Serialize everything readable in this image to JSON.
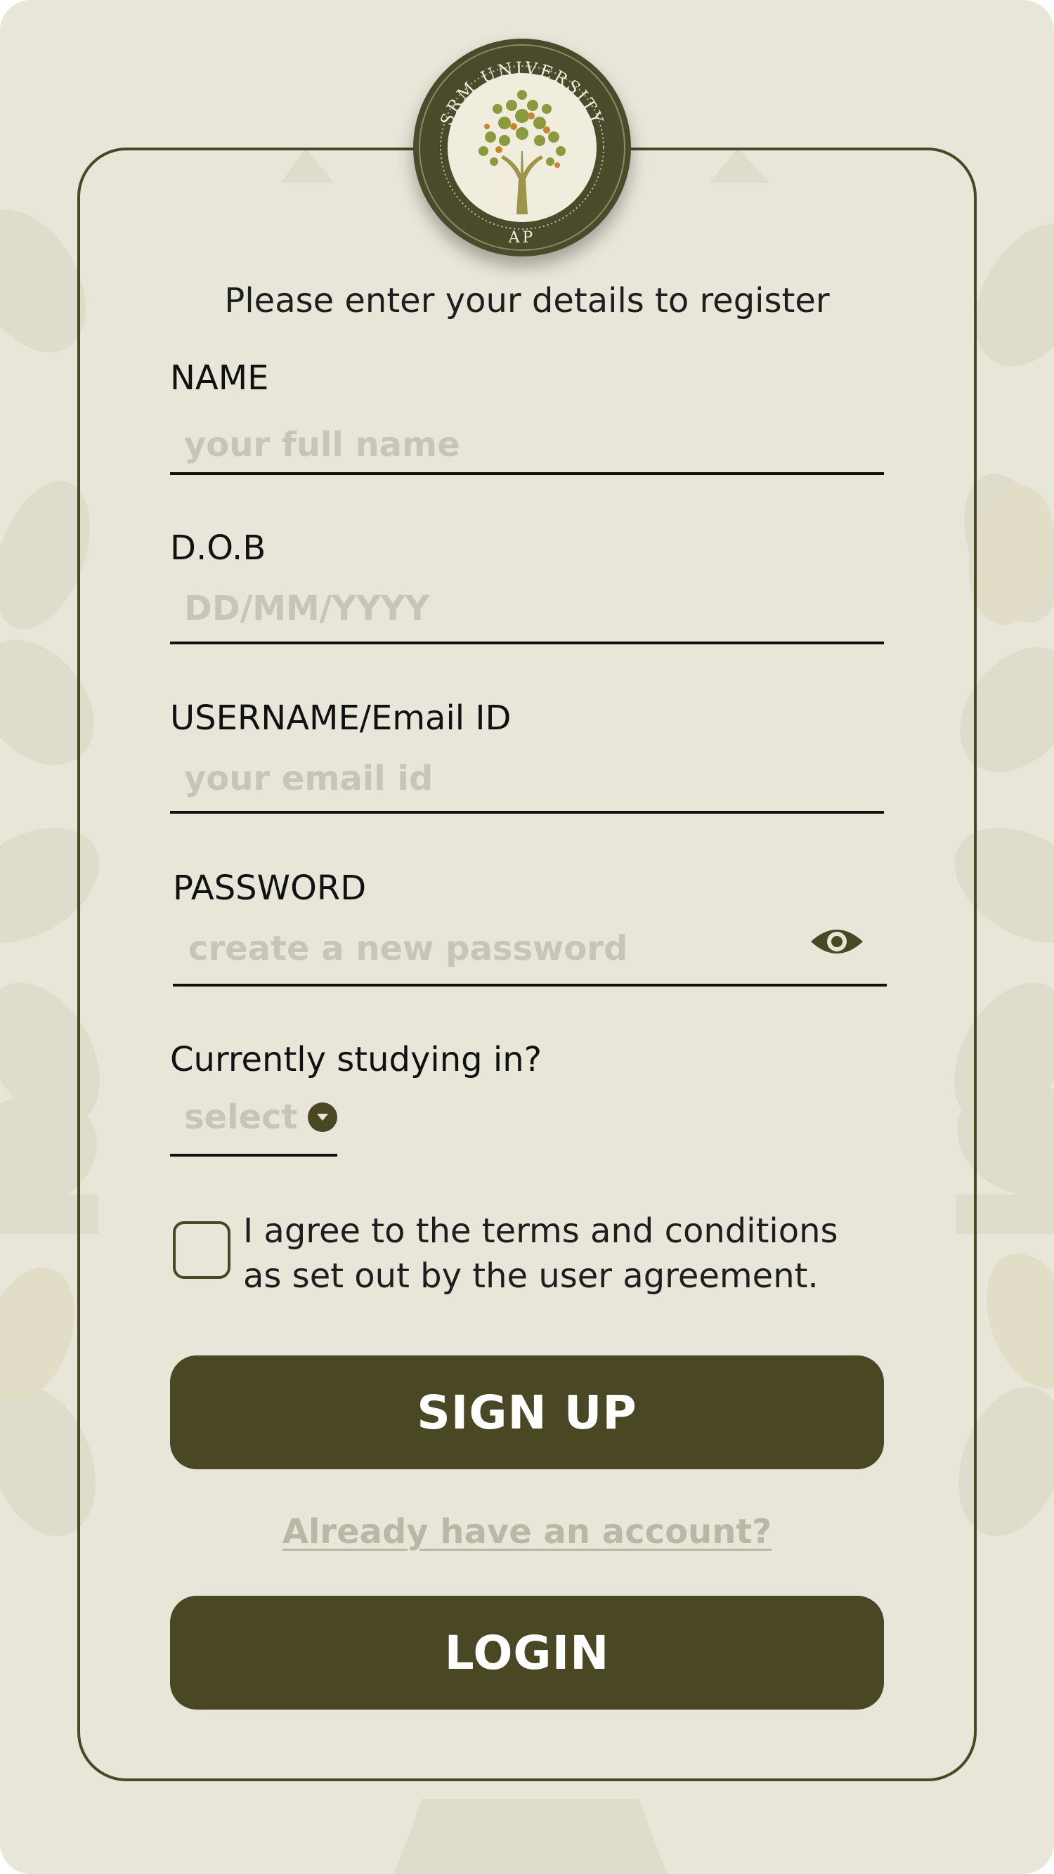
{
  "logo": {
    "top_text": "SRM UNIVERSITY",
    "bottom_text": "AP"
  },
  "form": {
    "subtitle": "Please enter your details to register",
    "name": {
      "label": "NAME",
      "placeholder": "your full name"
    },
    "dob": {
      "label": "D.O.B",
      "placeholder": "DD/MM/YYYY"
    },
    "username": {
      "label": "USERNAME/Email ID",
      "placeholder": "your email id"
    },
    "password": {
      "label": "PASSWORD",
      "placeholder": "create a new password",
      "icon": "eye-icon"
    },
    "studying": {
      "label": "Currently studying in?",
      "selected": "select",
      "icon": "chevron-down-icon"
    },
    "terms": {
      "line1": "I agree to the terms and conditions",
      "line2": "as set out by the user agreement.",
      "checked": false
    }
  },
  "actions": {
    "signup_label": "SIGN UP",
    "already_label": "Already have an account?",
    "login_label": "LOGIN"
  },
  "colors": {
    "background": "#e8e6d8",
    "accent": "#4a4724",
    "placeholder": "#c7c5b8",
    "link": "#b9b7a6"
  }
}
